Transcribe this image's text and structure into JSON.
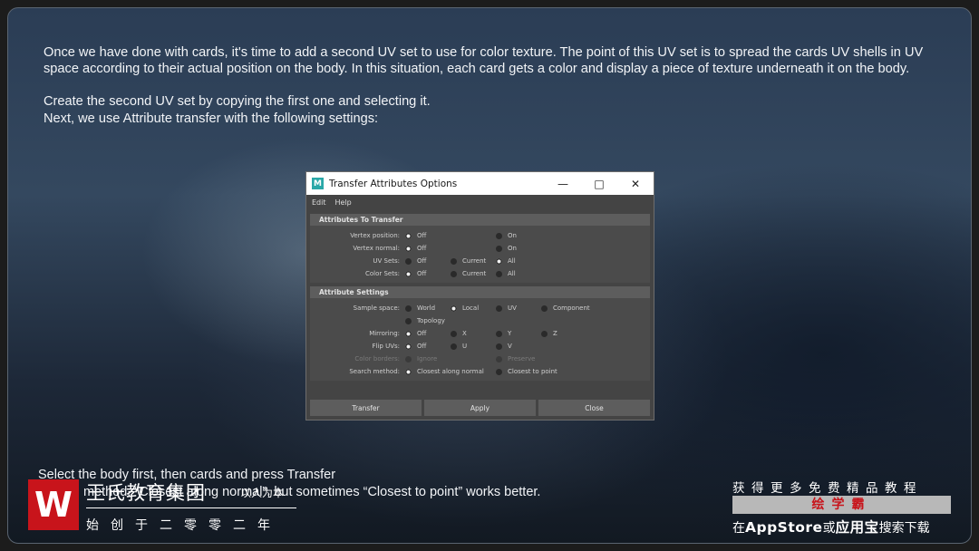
{
  "intro": {
    "paragraph1": "Once we have done with cards, it's time to add a second UV set to use for color texture. The point of this UV set is to spread the cards UV shells in UV space according to their actual position on the body. In this situation, each card gets a color and display a piece of texture underneath it on the body.",
    "line2": "Create the second UV set by copying the first one and selecting it.",
    "line3": "Next, we use Attribute transfer with the following settings:"
  },
  "dialog": {
    "title": "Transfer Attributes Options",
    "menu": [
      "Edit",
      "Help"
    ],
    "section1": {
      "header": "Attributes To Transfer",
      "rows": [
        {
          "label": "Vertex position:",
          "opt1": "Off",
          "opt3": "On"
        },
        {
          "label": "Vertex normal:",
          "opt1": "Off",
          "opt3": "On"
        },
        {
          "label": "UV Sets:",
          "opt1": "Off",
          "opt2": "Current",
          "opt3": "All"
        },
        {
          "label": "Color Sets:",
          "opt1": "Off",
          "opt2": "Current",
          "opt3": "All"
        }
      ]
    },
    "section2": {
      "header": "Attribute Settings",
      "sample_label": "Sample space:",
      "sample_opts": [
        "World",
        "Local",
        "UV",
        "Component",
        "Topology"
      ],
      "mirror_label": "Mirroring:",
      "mirror_opts": [
        "Off",
        "X",
        "Y",
        "Z"
      ],
      "flip_label": "Flip UVs:",
      "flip_opts": [
        "Off",
        "U",
        "V"
      ],
      "borders_label": "Color borders:",
      "borders_opts": [
        "Ignore",
        "Preserve"
      ],
      "search_label": "Search method:",
      "search_opts": [
        "Closest along normal",
        "Closest to point"
      ]
    },
    "buttons": {
      "transfer": "Transfer",
      "apply": "Apply",
      "close": "Close"
    }
  },
  "caption": {
    "line1": "Select the body first, then cards and press Transfer",
    "line2": "Search method: “Closest along normal”, but sometimes “Closest to point” works better."
  },
  "watermark": {
    "logo_letter": "W",
    "name": "王氏教育集团",
    "sub": "以人为本",
    "motto": "始创于二零零二年",
    "ad_top": "获得更多免费精品教程",
    "ad_mid": "绘学霸",
    "ad_prefix": "在",
    "ad_app": "AppStore",
    "ad_or": "或",
    "ad_store": "应用宝",
    "ad_suffix": "搜索下载"
  }
}
